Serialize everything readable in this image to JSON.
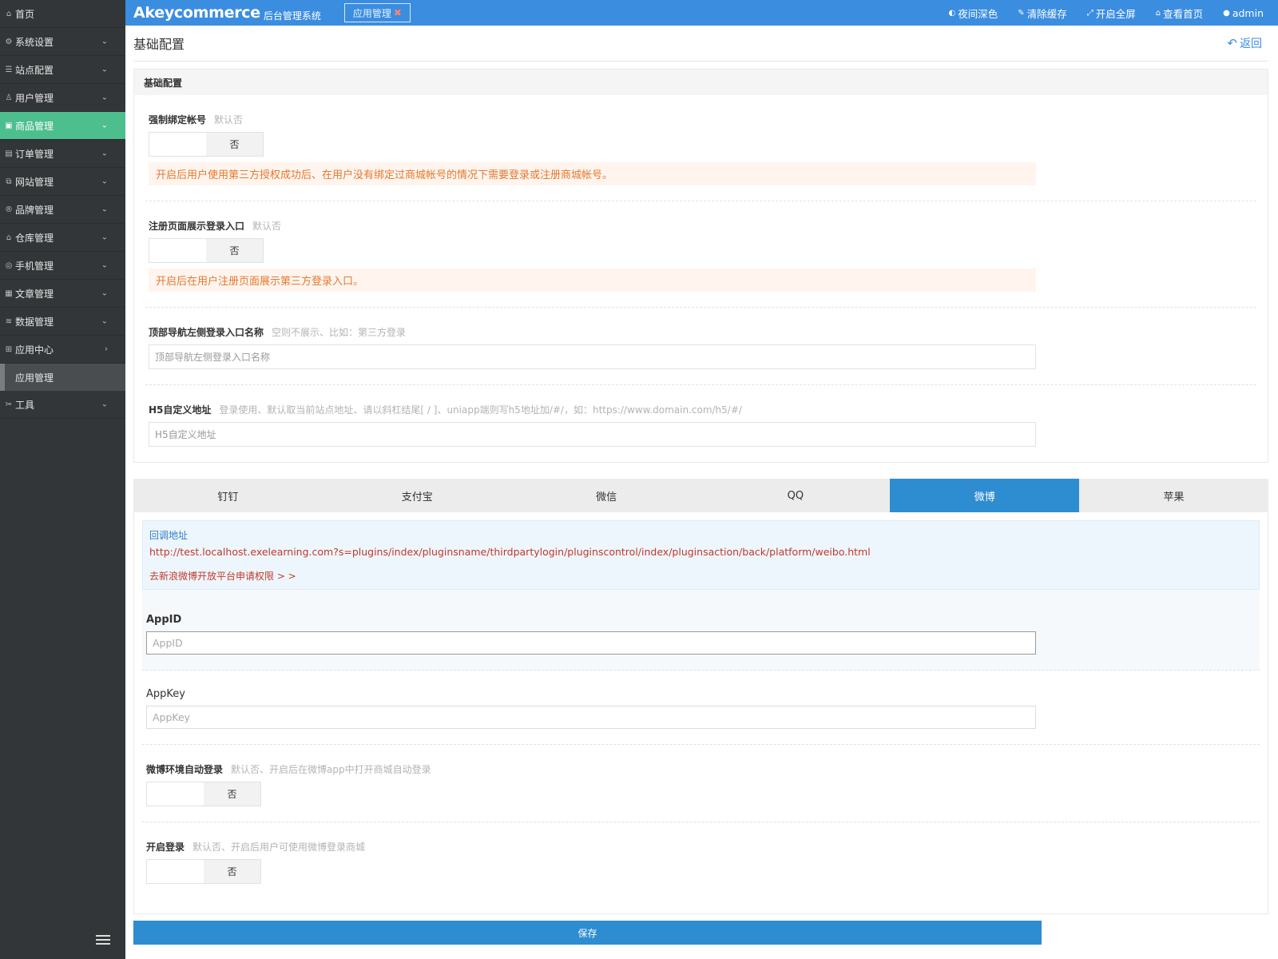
{
  "sidebar": {
    "items": [
      {
        "label": "首页",
        "icon": "home-icon",
        "chevron": ""
      },
      {
        "label": "系统设置",
        "icon": "gear-icon",
        "chevron": "⌄"
      },
      {
        "label": "站点配置",
        "icon": "sliders-icon",
        "chevron": "⌄"
      },
      {
        "label": "用户管理",
        "icon": "user-icon",
        "chevron": "⌄"
      },
      {
        "label": "商品管理",
        "icon": "bag-icon",
        "chevron": "⌄"
      },
      {
        "label": "订单管理",
        "icon": "order-icon",
        "chevron": "⌄"
      },
      {
        "label": "网站管理",
        "icon": "website-icon",
        "chevron": "⌄"
      },
      {
        "label": "品牌管理",
        "icon": "brand-icon",
        "chevron": "⌄"
      },
      {
        "label": "仓库管理",
        "icon": "warehouse-icon",
        "chevron": "⌄"
      },
      {
        "label": "手机管理",
        "icon": "mobile-icon",
        "chevron": "⌄"
      },
      {
        "label": "文章管理",
        "icon": "article-icon",
        "chevron": "⌄"
      },
      {
        "label": "数据管理",
        "icon": "database-icon",
        "chevron": "⌄"
      },
      {
        "label": "应用中心",
        "icon": "apps-icon",
        "chevron": "›"
      }
    ],
    "sub_item": "应用管理",
    "tools": {
      "label": "工具",
      "icon": "tools-icon",
      "chevron": "⌄"
    },
    "active_index": 4
  },
  "header": {
    "brand": "Akeycommerce",
    "brand_sub": "后台管理系统",
    "open_tab": "应用管理",
    "actions": [
      {
        "label": "夜间深色",
        "icon": "contrast-icon",
        "glyph": "◐"
      },
      {
        "label": "清除缓存",
        "icon": "brush-icon",
        "glyph": "✎"
      },
      {
        "label": "开启全屏",
        "icon": "fullscreen-icon",
        "glyph": "⤢"
      },
      {
        "label": "查看首页",
        "icon": "home-icon",
        "glyph": "⌂"
      },
      {
        "label": "admin",
        "icon": "user-icon",
        "glyph": "●"
      }
    ]
  },
  "page": {
    "title": "基础配置",
    "back_label": "返回"
  },
  "basic": {
    "heading": "基础配置",
    "force_bind": {
      "label": "强制绑定帐号",
      "hint": "默认否",
      "value": "否",
      "tip": "开启后用户使用第三方授权成功后、在用户没有绑定过商城帐号的情况下需要登录或注册商城帐号。"
    },
    "register_entry": {
      "label": "注册页面展示登录入口",
      "hint": "默认否",
      "value": "否",
      "tip": "开启后在用户注册页面展示第三方登录入口。"
    },
    "nav_name": {
      "label": "顶部导航左侧登录入口名称",
      "hint": "空则不展示、比如：第三方登录",
      "placeholder": "顶部导航左侧登录入口名称"
    },
    "h5_url": {
      "label": "H5自定义地址",
      "hint": "登录使用、默认取当前站点地址、请以斜杠结尾[ / ]、uniapp端则写h5地址加/#/，如：https://www.domain.com/h5/#/",
      "placeholder": "H5自定义地址"
    }
  },
  "tabs": [
    "钉钉",
    "支付宝",
    "微信",
    "QQ",
    "微博",
    "苹果"
  ],
  "active_tab": 4,
  "weibo": {
    "callback_title": "回调地址",
    "callback_url": "http://test.localhost.exelearning.com?s=plugins/index/pluginsname/thirdpartylogin/pluginscontrol/index/pluginsaction/back/platform/weibo.html",
    "apply_link": "去新浪微博开放平台申请权限 > >",
    "appid": {
      "label": "AppID",
      "placeholder": "AppID"
    },
    "appkey": {
      "label": "AppKey",
      "placeholder": "AppKey"
    },
    "auto_login": {
      "label": "微博环境自动登录",
      "hint": "默认否、开启后在微博app中打开商城自动登录",
      "value": "否"
    },
    "enable_login": {
      "label": "开启登录",
      "hint": "默认否、开启后用户可使用微博登录商城",
      "value": "否"
    }
  },
  "save_label": "保存",
  "colors": {
    "topbar": "#3b8de0",
    "sidebar": "#333638",
    "active_nav": "#4dbe8e",
    "tab_active": "#2e8cd1",
    "tip_text": "#e5782f",
    "link_red": "#c0392b"
  }
}
